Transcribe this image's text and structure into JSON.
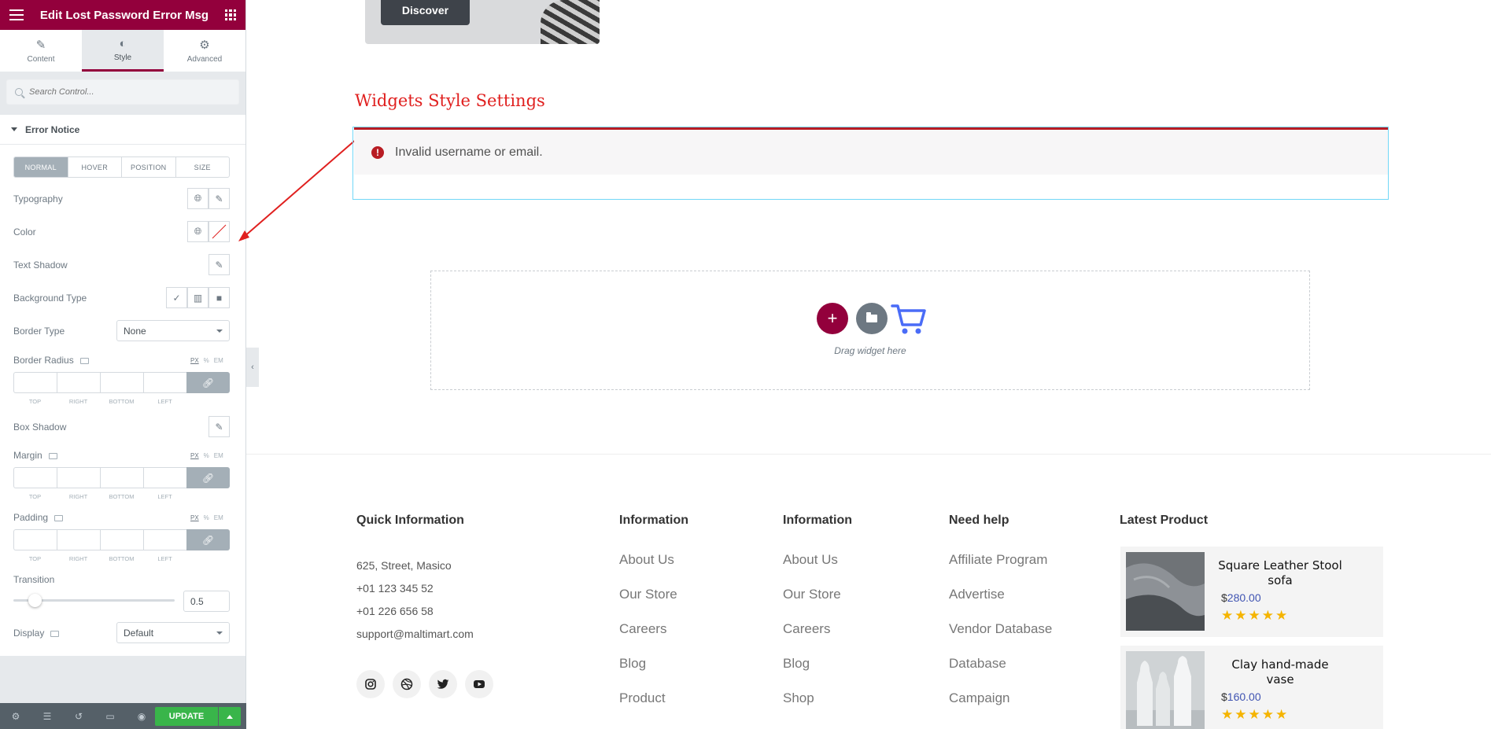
{
  "panel": {
    "title": "Edit Lost Password Error Msg",
    "tabs": [
      {
        "label": "Content",
        "icon": "pencil-icon"
      },
      {
        "label": "Style",
        "icon": "half-circle-icon"
      },
      {
        "label": "Advanced",
        "icon": "gear-icon"
      }
    ],
    "search_placeholder": "Search Control...",
    "section_title": "Error Notice",
    "state_tabs": [
      "NORMAL",
      "HOVER",
      "POSITION",
      "SIZE"
    ],
    "controls": {
      "typography": "Typography",
      "color": "Color",
      "text_shadow": "Text Shadow",
      "background_type": "Background Type",
      "border_type": "Border Type",
      "border_type_value": "None",
      "border_radius": "Border Radius",
      "box_shadow": "Box Shadow",
      "margin": "Margin",
      "padding": "Padding",
      "transition": "Transition",
      "transition_value": "0.5",
      "display": "Display",
      "display_value": "Default"
    },
    "units": {
      "px": "PX",
      "pct": "%",
      "em": "EM"
    },
    "dimension_labels": [
      "TOP",
      "RIGHT",
      "BOTTOM",
      "LEFT"
    ],
    "footer": {
      "update_label": "UPDATE"
    }
  },
  "canvas": {
    "discover_label": "Discover",
    "annotation_title": "Widgets Style Settings",
    "error_message": "Invalid username or email.",
    "drop_hint": "Drag widget here"
  },
  "footer": {
    "quick_info": {
      "title": "Quick Information",
      "lines": [
        "625, Street, Masico",
        "+01 123 345 52",
        "+01 226 656 58",
        "support@maltimart.com"
      ]
    },
    "information1": {
      "title": "Information",
      "links": [
        "About Us",
        "Our Store",
        "Careers",
        "Blog",
        "Product"
      ]
    },
    "information2": {
      "title": "Information",
      "links": [
        "About Us",
        "Our Store",
        "Careers",
        "Blog",
        "Shop"
      ]
    },
    "need_help": {
      "title": "Need help",
      "links": [
        "Affiliate Program",
        "Advertise",
        "Vendor Database",
        "Database",
        "Campaign"
      ]
    },
    "latest_product": {
      "title": "Latest Product",
      "products": [
        {
          "name": "Square Leather Stool sofa",
          "currency": "$",
          "price": "280.00",
          "rating": 5
        },
        {
          "name": "Clay hand-made vase",
          "currency": "$",
          "price": "160.00",
          "rating": 5
        }
      ]
    },
    "social_icons": [
      "instagram-icon",
      "dribbble-icon",
      "twitter-icon",
      "youtube-icon"
    ]
  },
  "colors": {
    "brand": "#93003c",
    "error_border": "#b81c23",
    "annotation": "#e0201f",
    "update_button": "#39b54a",
    "price": "#4054b2",
    "stars": "#f5b400"
  }
}
